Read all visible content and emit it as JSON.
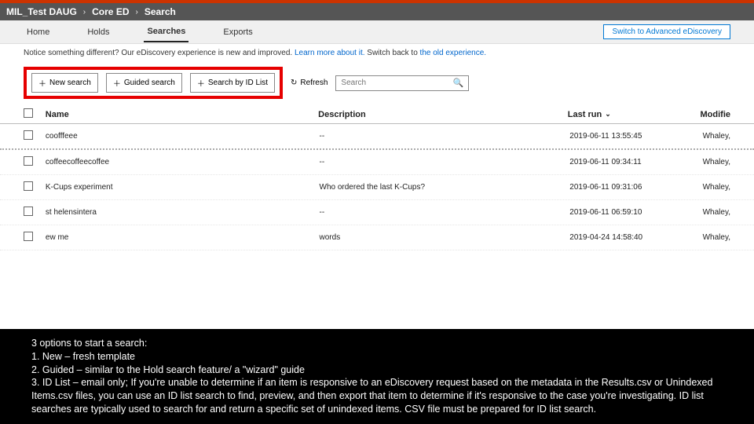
{
  "breadcrumb": {
    "a": "MIL_Test DAUG",
    "b": "Core ED",
    "c": "Search"
  },
  "tabs": {
    "home": "Home",
    "holds": "Holds",
    "searches": "Searches",
    "exports": "Exports",
    "adv": "Switch to Advanced eDiscovery"
  },
  "notice": {
    "pre": "Notice something different? Our eDiscovery experience is new and improved. ",
    "learn": "Learn more about it.",
    "mid": " Switch back to ",
    "old": "the old experience."
  },
  "toolbar": {
    "new": "New search",
    "guided": "Guided search",
    "idlist": "Search by ID List",
    "refresh": "Refresh",
    "search_ph": "Search"
  },
  "headers": {
    "name": "Name",
    "desc": "Description",
    "last": "Last run",
    "mod": "Modifie"
  },
  "rows": [
    {
      "name": "coofffeee",
      "desc": "--",
      "last": "2019-06-11 13:55:45",
      "mod": "Whaley,"
    },
    {
      "name": "coffeecoffeecoffee",
      "desc": "--",
      "last": "2019-06-11 09:34:11",
      "mod": "Whaley,"
    },
    {
      "name": "K-Cups experiment",
      "desc": "Who ordered the last K-Cups?",
      "last": "2019-06-11 09:31:06",
      "mod": "Whaley,"
    },
    {
      "name": "st helensintera",
      "desc": "--",
      "last": "2019-06-11 06:59:10",
      "mod": "Whaley,"
    },
    {
      "name": "ew me",
      "desc": "words",
      "last": "2019-04-24 14:58:40",
      "mod": "Whaley,"
    }
  ],
  "caption": {
    "l0": "3 options to start a search:",
    "l1": "1. New – fresh template",
    "l2": "2. Guided – similar to the Hold search feature/ a \"wizard\" guide",
    "l3": "3. ID List – email only; If you're unable to determine if an item is responsive to an eDiscovery request based on the metadata in the Results.csv or Unindexed Items.csv files, you can use an ID list search to find, preview, and then export that item to determine if it's responsive to the case you're investigating. ID list searches are typically used to search for and return a specific set of unindexed items. CSV file must be prepared for ID list search."
  }
}
